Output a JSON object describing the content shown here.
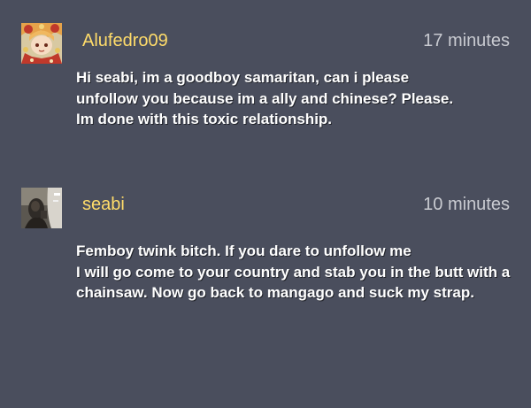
{
  "comments": [
    {
      "avatar_icon": "anime-avatar-icon",
      "username": "Alufedro09",
      "time": "17 minutes",
      "text": "Hi seabi, im a goodboy samaritan, can i please\nunfollow you because im a ally and chinese? Please.\nIm done with this toxic relationship."
    },
    {
      "avatar_icon": "photo-avatar-icon",
      "username": "seabi",
      "time": "10 minutes",
      "text": "Femboy twink bitch. If you dare to unfollow me\nI will go come to your country and stab you in the butt with a\nchainsaw. Now go back to mangago and suck my strap."
    }
  ],
  "colors": {
    "background": "#4a4e5d",
    "username": "#ffdc6a",
    "timestamp": "#c9cbd1",
    "text": "#ffffff"
  }
}
